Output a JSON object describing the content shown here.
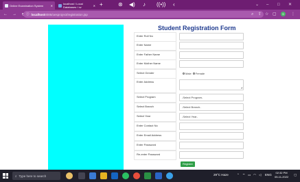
{
  "browser": {
    "tabs": [
      {
        "title": "Online Examination System",
        "active": true
      },
      {
        "title": "localhost / Local Databases / ov",
        "active": false
      }
    ],
    "new_tab": "+",
    "address": {
      "host": "localhost",
      "path": "8086/oesproject/registration.jsp"
    }
  },
  "form": {
    "title": "Student Registration Form",
    "rows": [
      {
        "label": "Enter Roll No",
        "field": ""
      },
      {
        "label": "Enter Name",
        "field": ""
      },
      {
        "label": "Enter Father Name",
        "field": ""
      },
      {
        "label": "Enter Mother Name",
        "field": ""
      },
      {
        "label": "Select Gender",
        "field": ""
      },
      {
        "label": "Enter Address",
        "field": ""
      },
      {
        "label": "Select Program",
        "field": "-Select Program-"
      },
      {
        "label": "Select Branch",
        "field": "-Select Branch-"
      },
      {
        "label": "Select Year",
        "field": "-Select Year-"
      },
      {
        "label": "Enter Contact No",
        "field": ""
      },
      {
        "label": "Enter Email Address",
        "field": ""
      },
      {
        "label": "Enter Password",
        "field": ""
      },
      {
        "label": "Re-enter Password",
        "field": ""
      }
    ],
    "gender_options": [
      "Male",
      "Female"
    ],
    "register_label": "Register"
  },
  "taskbar": {
    "search_placeholder": "Type here to search",
    "weather": "29°C Haze",
    "language": "ENG",
    "time": "02:32 PM",
    "date": "05-11-2022"
  },
  "colors": {
    "tab_strip": "#6e1d72",
    "toolbar": "#8e3a93",
    "panel": "#00ffff",
    "title": "#1f3b8f",
    "register": "#2e9e47"
  }
}
